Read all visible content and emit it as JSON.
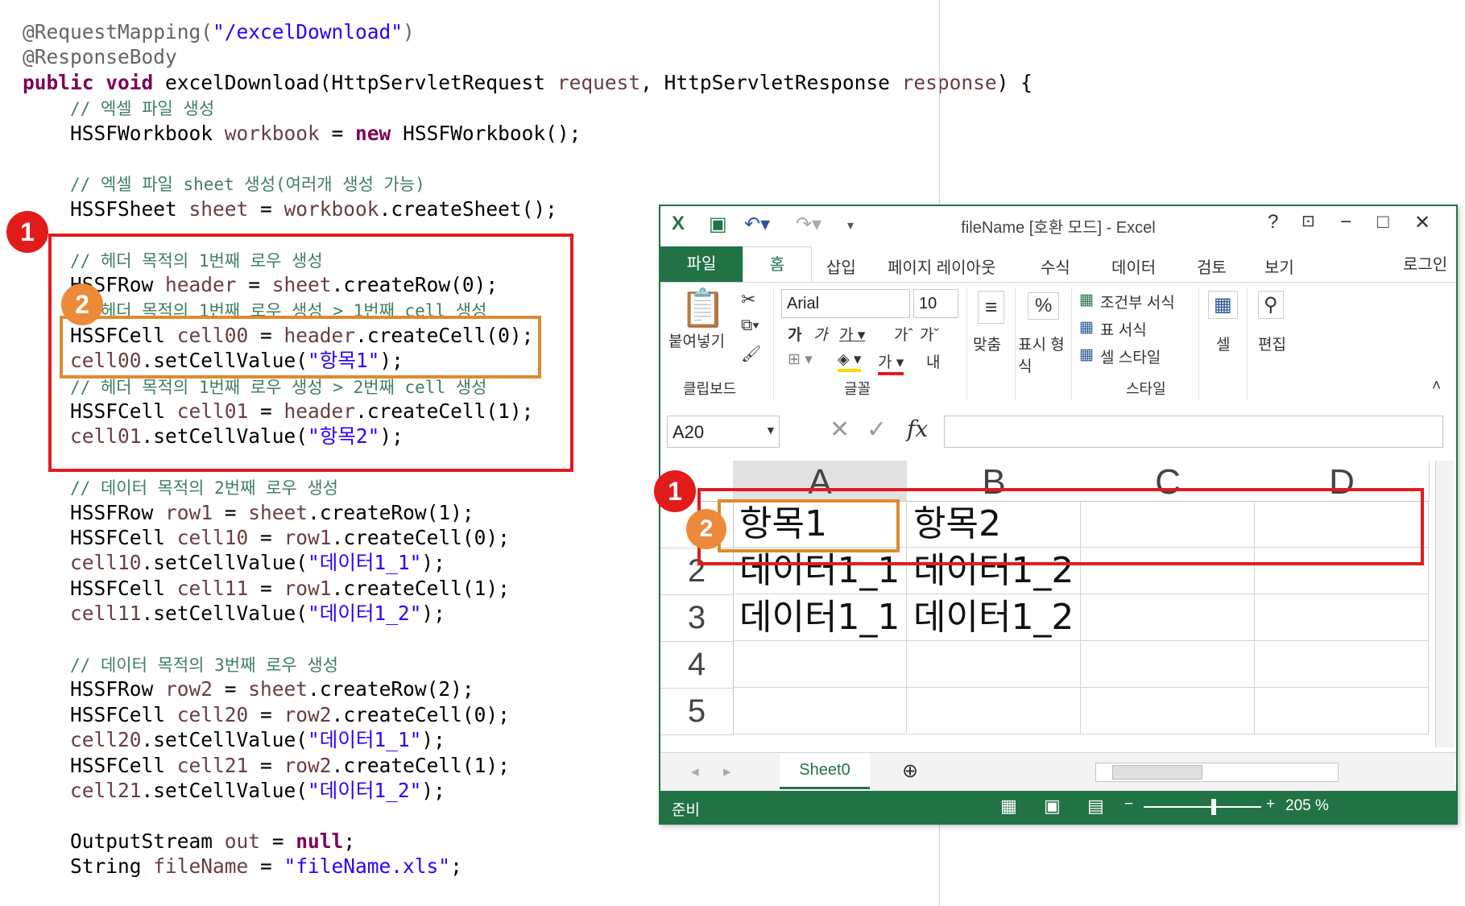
{
  "code": {
    "lines": [
      [
        {
          "t": "@RequestMapping(",
          "c": "ann"
        },
        {
          "t": "\"/excelDownload\"",
          "c": "st"
        },
        {
          "t": ")",
          "c": "ann"
        }
      ],
      [
        {
          "t": "@ResponseBody",
          "c": "ann"
        }
      ],
      [
        {
          "t": "public",
          "c": "kw"
        },
        {
          "t": " ",
          "c": "fn"
        },
        {
          "t": "void",
          "c": "kw"
        },
        {
          "t": " excelDownload(HttpServletRequest ",
          "c": "fn"
        },
        {
          "t": "request",
          "c": "vr"
        },
        {
          "t": ", HttpServletResponse ",
          "c": "fn"
        },
        {
          "t": "response",
          "c": "vr"
        },
        {
          "t": ") {",
          "c": "fn"
        }
      ],
      [
        {
          "t": "    ",
          "c": "fn"
        },
        {
          "t": "// 엑셀 파일 생성",
          "c": "cm"
        }
      ],
      [
        {
          "t": "    HSSFWorkbook ",
          "c": "fn"
        },
        {
          "t": "workbook",
          "c": "vr"
        },
        {
          "t": " = ",
          "c": "fn"
        },
        {
          "t": "new",
          "c": "kw"
        },
        {
          "t": " HSSFWorkbook();",
          "c": "fn"
        }
      ],
      [],
      [
        {
          "t": "    ",
          "c": "fn"
        },
        {
          "t": "// 엑셀 파일 sheet 생성(여러개 생성 가능)",
          "c": "cm"
        }
      ],
      [
        {
          "t": "    HSSFSheet ",
          "c": "fn"
        },
        {
          "t": "sheet",
          "c": "vr"
        },
        {
          "t": " = ",
          "c": "fn"
        },
        {
          "t": "workbook",
          "c": "vr"
        },
        {
          "t": ".createSheet();",
          "c": "fn"
        }
      ],
      [],
      [
        {
          "t": "    ",
          "c": "fn"
        },
        {
          "t": "// 헤더 목적의 1번째 로우 생성",
          "c": "cm"
        }
      ],
      [
        {
          "t": "    HSSFRow ",
          "c": "fn"
        },
        {
          "t": "header",
          "c": "vr"
        },
        {
          "t": " = ",
          "c": "fn"
        },
        {
          "t": "sheet",
          "c": "vr"
        },
        {
          "t": ".createRow(0);",
          "c": "fn"
        }
      ],
      [
        {
          "t": "    ",
          "c": "fn"
        },
        {
          "t": "// 헤더 목적의 1번째 로우 생성 > 1번째 cell 생성",
          "c": "cm"
        }
      ],
      [
        {
          "t": "    HSSFCell ",
          "c": "fn"
        },
        {
          "t": "cell00",
          "c": "vr"
        },
        {
          "t": " = ",
          "c": "fn"
        },
        {
          "t": "header",
          "c": "vr"
        },
        {
          "t": ".createCell(0);",
          "c": "fn"
        }
      ],
      [
        {
          "t": "    ",
          "c": "fn"
        },
        {
          "t": "cell00",
          "c": "vr"
        },
        {
          "t": ".setCellValue(",
          "c": "fn"
        },
        {
          "t": "\"항목1\"",
          "c": "st"
        },
        {
          "t": ");",
          "c": "fn"
        }
      ],
      [
        {
          "t": "    ",
          "c": "fn"
        },
        {
          "t": "// 헤더 목적의 1번째 로우 생성 > 2번째 cell 생성",
          "c": "cm"
        }
      ],
      [
        {
          "t": "    HSSFCell ",
          "c": "fn"
        },
        {
          "t": "cell01",
          "c": "vr"
        },
        {
          "t": " = ",
          "c": "fn"
        },
        {
          "t": "header",
          "c": "vr"
        },
        {
          "t": ".createCell(1);",
          "c": "fn"
        }
      ],
      [
        {
          "t": "    ",
          "c": "fn"
        },
        {
          "t": "cell01",
          "c": "vr"
        },
        {
          "t": ".setCellValue(",
          "c": "fn"
        },
        {
          "t": "\"항목2\"",
          "c": "st"
        },
        {
          "t": ");",
          "c": "fn"
        }
      ],
      [],
      [
        {
          "t": "    ",
          "c": "fn"
        },
        {
          "t": "// 데이터 목적의 2번째 로우 생성",
          "c": "cm"
        }
      ],
      [
        {
          "t": "    HSSFRow ",
          "c": "fn"
        },
        {
          "t": "row1",
          "c": "vr"
        },
        {
          "t": " = ",
          "c": "fn"
        },
        {
          "t": "sheet",
          "c": "vr"
        },
        {
          "t": ".createRow(1);",
          "c": "fn"
        }
      ],
      [
        {
          "t": "    HSSFCell ",
          "c": "fn"
        },
        {
          "t": "cell10",
          "c": "vr"
        },
        {
          "t": " = ",
          "c": "fn"
        },
        {
          "t": "row1",
          "c": "vr"
        },
        {
          "t": ".createCell(0);",
          "c": "fn"
        }
      ],
      [
        {
          "t": "    ",
          "c": "fn"
        },
        {
          "t": "cell10",
          "c": "vr"
        },
        {
          "t": ".setCellValue(",
          "c": "fn"
        },
        {
          "t": "\"데이터1_1\"",
          "c": "st"
        },
        {
          "t": ");",
          "c": "fn"
        }
      ],
      [
        {
          "t": "    HSSFCell ",
          "c": "fn"
        },
        {
          "t": "cell11",
          "c": "vr"
        },
        {
          "t": " = ",
          "c": "fn"
        },
        {
          "t": "row1",
          "c": "vr"
        },
        {
          "t": ".createCell(1);",
          "c": "fn"
        }
      ],
      [
        {
          "t": "    ",
          "c": "fn"
        },
        {
          "t": "cell11",
          "c": "vr"
        },
        {
          "t": ".setCellValue(",
          "c": "fn"
        },
        {
          "t": "\"데이터1_2\"",
          "c": "st"
        },
        {
          "t": ");",
          "c": "fn"
        }
      ],
      [],
      [
        {
          "t": "    ",
          "c": "fn"
        },
        {
          "t": "// 데이터 목적의 3번째 로우 생성",
          "c": "cm"
        }
      ],
      [
        {
          "t": "    HSSFRow ",
          "c": "fn"
        },
        {
          "t": "row2",
          "c": "vr"
        },
        {
          "t": " = ",
          "c": "fn"
        },
        {
          "t": "sheet",
          "c": "vr"
        },
        {
          "t": ".createRow(2);",
          "c": "fn"
        }
      ],
      [
        {
          "t": "    HSSFCell ",
          "c": "fn"
        },
        {
          "t": "cell20",
          "c": "vr"
        },
        {
          "t": " = ",
          "c": "fn"
        },
        {
          "t": "row2",
          "c": "vr"
        },
        {
          "t": ".createCell(0);",
          "c": "fn"
        }
      ],
      [
        {
          "t": "    ",
          "c": "fn"
        },
        {
          "t": "cell20",
          "c": "vr"
        },
        {
          "t": ".setCellValue(",
          "c": "fn"
        },
        {
          "t": "\"데이터1_1\"",
          "c": "st"
        },
        {
          "t": ");",
          "c": "fn"
        }
      ],
      [
        {
          "t": "    HSSFCell ",
          "c": "fn"
        },
        {
          "t": "cell21",
          "c": "vr"
        },
        {
          "t": " = ",
          "c": "fn"
        },
        {
          "t": "row2",
          "c": "vr"
        },
        {
          "t": ".createCell(1);",
          "c": "fn"
        }
      ],
      [
        {
          "t": "    ",
          "c": "fn"
        },
        {
          "t": "cell21",
          "c": "vr"
        },
        {
          "t": ".setCellValue(",
          "c": "fn"
        },
        {
          "t": "\"데이터1_2\"",
          "c": "st"
        },
        {
          "t": ");",
          "c": "fn"
        }
      ],
      [],
      [
        {
          "t": "    OutputStream ",
          "c": "fn"
        },
        {
          "t": "out",
          "c": "vr"
        },
        {
          "t": " = ",
          "c": "fn"
        },
        {
          "t": "null",
          "c": "kw"
        },
        {
          "t": ";",
          "c": "fn"
        }
      ],
      [
        {
          "t": "    String ",
          "c": "fn"
        },
        {
          "t": "fileName",
          "c": "vr"
        },
        {
          "t": " = ",
          "c": "fn"
        },
        {
          "t": "\"fileName.xls\"",
          "c": "st"
        },
        {
          "t": ";",
          "c": "fn"
        }
      ]
    ]
  },
  "badges": {
    "one": "1",
    "two": "2"
  },
  "excel": {
    "title": "fileName  [호환 모드] - Excel",
    "icons": {
      "excel": "excel-logo-icon",
      "save": "save-icon",
      "undo": "undo-icon",
      "redo": "redo-icon",
      "customize": "customize-qat-icon"
    },
    "window_buttons": {
      "help": "?",
      "restore_ribbon": "ribbon-display-icon",
      "minimize": "−",
      "maximize": "□",
      "close": "✕"
    },
    "tabs": [
      "파일",
      "홈",
      "삽입",
      "페이지 레이아웃",
      "수식",
      "데이터",
      "검토",
      "보기"
    ],
    "login": "로그인",
    "ribbon": {
      "paste": "붙여넣기",
      "clipboard": "클립보드",
      "font_name": "Arial",
      "font_size": "10",
      "font_group": "글꼴",
      "align": "맞춤",
      "number_format": "표시 형식",
      "number_symbol": "%",
      "cond_format": "조건부 서식",
      "table_format": "표 서식",
      "cell_style": "셀 스타일",
      "styles": "스타일",
      "cells": "셀",
      "edit": "편집",
      "font_buttons": [
        "가",
        "가",
        "가",
        "가",
        "가"
      ],
      "wrap": "내"
    },
    "name_box": "A20",
    "fx": "fx",
    "columns": [
      "A",
      "B",
      "C",
      "D"
    ],
    "rows": [
      "1",
      "2",
      "3",
      "4",
      "5"
    ],
    "cells": [
      [
        "항목1",
        "항목2",
        "",
        ""
      ],
      [
        "데이터1_1",
        "데이터1_2",
        "",
        ""
      ],
      [
        "데이터1_1",
        "데이터1_2",
        "",
        ""
      ],
      [
        "",
        "",
        "",
        ""
      ],
      [
        "",
        "",
        "",
        ""
      ]
    ],
    "sheet_tab": "Sheet0",
    "status": "준비",
    "zoom": "205 %"
  }
}
